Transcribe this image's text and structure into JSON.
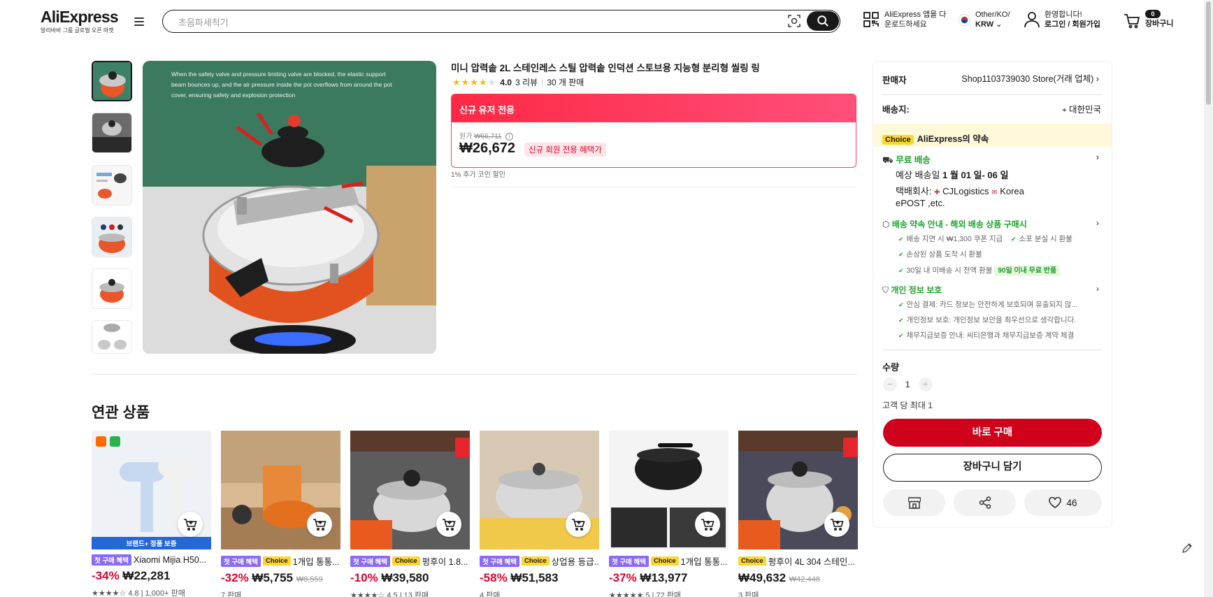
{
  "header": {
    "logo": "AliExpress",
    "logo_sub": "알리바바 그룹 글로벌 오픈 마켓",
    "search_placeholder": "초음파세척기",
    "app_promo_line1": "AliExpress 앱을 다",
    "app_promo_line2": "운로드하세요",
    "region_line1": "Other/KO/",
    "region_line2": "KRW",
    "account_line1": "환영합니다!",
    "account_line2": "로그인 / 회원가입",
    "cart_count": "0",
    "cart_label": "장바구니"
  },
  "product": {
    "image_caption": "When the safety valve and pressure limiting valve are blocked, the elastic support beam bounces up, and the air pressure inside the pot overflows from around the pot cover, ensuring safety and explosion protection",
    "title": "미니 압력솥 2L 스테인레스 스틸 압력솥 인덕션 스토브용 지능형 분리형 씰링 링",
    "rating": "4.0",
    "reviews": "3 리뷰",
    "sold": "30 개 판매",
    "promo_band": "신규 유저 전용",
    "orig_label": "원가",
    "orig_price": "₩66,711",
    "price": "₩26,672",
    "promo_tag": "신규 회원 전용 혜택가",
    "coin_note": "1% 추가 코인 할인"
  },
  "panel": {
    "seller_label": "판매자",
    "seller_name": "Shop1103739030 Store(거래 업체)",
    "ship_label": "배송지:",
    "ship_to": "대한민국",
    "choice_badge": "Choice",
    "choice_promise": "AliExpress의 약속",
    "free_ship": "무료 배송",
    "est_label": "예상 배송일",
    "est_date": "1 월 01 일- 06 일",
    "carrier_label": "택배회사:",
    "carrier1": "CJLogistics",
    "carrier2": "Korea",
    "carrier3": "ePOST ,etc.",
    "guarantee_title": "배송 약속 안내 - 해외 배송 상품 구매시",
    "g1": "배송 지연 시 ₩1,300 쿠폰 지급",
    "g2": "소포 분실 시 환불",
    "g3": "손상된 상품 도착 시 환불",
    "g4": "30일 내 미배송 시 전액 환불",
    "g4_pill": "90일 이내 무료 반품",
    "privacy_title": "개인 정보 보호",
    "p1": "안심 결제: 카드 정보는 안전하게 보호되며 유출되지 않...",
    "p2": "개인정보 보호: 개인정보 보안을 최우선으로 생각합니다.",
    "p3": "채무지급보증 안내: 씨티은행과 채무지급보증 계약 체결",
    "qty_label": "수량",
    "qty_value": "1",
    "qty_minus": "−",
    "qty_plus": "+",
    "limit": "고객 당 최대 1",
    "buy_now": "바로 구매",
    "add_cart": "장바구니 담기",
    "wish_count": "46"
  },
  "related": {
    "title": "연관 상품",
    "items": [
      {
        "badge1": "첫 구매 혜택",
        "badge2": "",
        "name": "Xiaomi Mijia H50...",
        "discount": "-34%",
        "price": "₩22,281",
        "old": "",
        "meta": "★★★★☆ 4.8  |  1,000+ 판매",
        "overlay": "브랜드+ 정품 보증"
      },
      {
        "badge1": "첫 구매 혜택",
        "badge2": "Choice",
        "name": "1개입 통통...",
        "discount": "-32%",
        "price": "₩5,755",
        "old": "₩8,559",
        "meta": "7 판매",
        "overlay": ""
      },
      {
        "badge1": "첫 구매 혜택",
        "badge2": "Choice",
        "name": "펑후이 1.8...",
        "discount": "-10%",
        "price": "₩39,580",
        "old": "",
        "meta": "★★★★☆ 4.5  |  13 판매",
        "overlay": ""
      },
      {
        "badge1": "첫 구매 혜택",
        "badge2": "Choice",
        "name": "상업용 등급...",
        "discount": "-58%",
        "price": "₩51,583",
        "old": "",
        "meta": "4 판매",
        "overlay": ""
      },
      {
        "badge1": "첫 구매 혜택",
        "badge2": "Choice",
        "name": "1개입 통통...",
        "discount": "-37%",
        "price": "₩13,977",
        "old": "",
        "meta": "★★★★★ 5  |  72 판매",
        "overlay": ""
      },
      {
        "badge1": "",
        "badge2": "Choice",
        "name": "펑후이 4L 304 스테인...",
        "discount": "",
        "price": "₩49,632",
        "old": "₩42,448",
        "meta": "3 판매",
        "overlay": ""
      }
    ]
  }
}
